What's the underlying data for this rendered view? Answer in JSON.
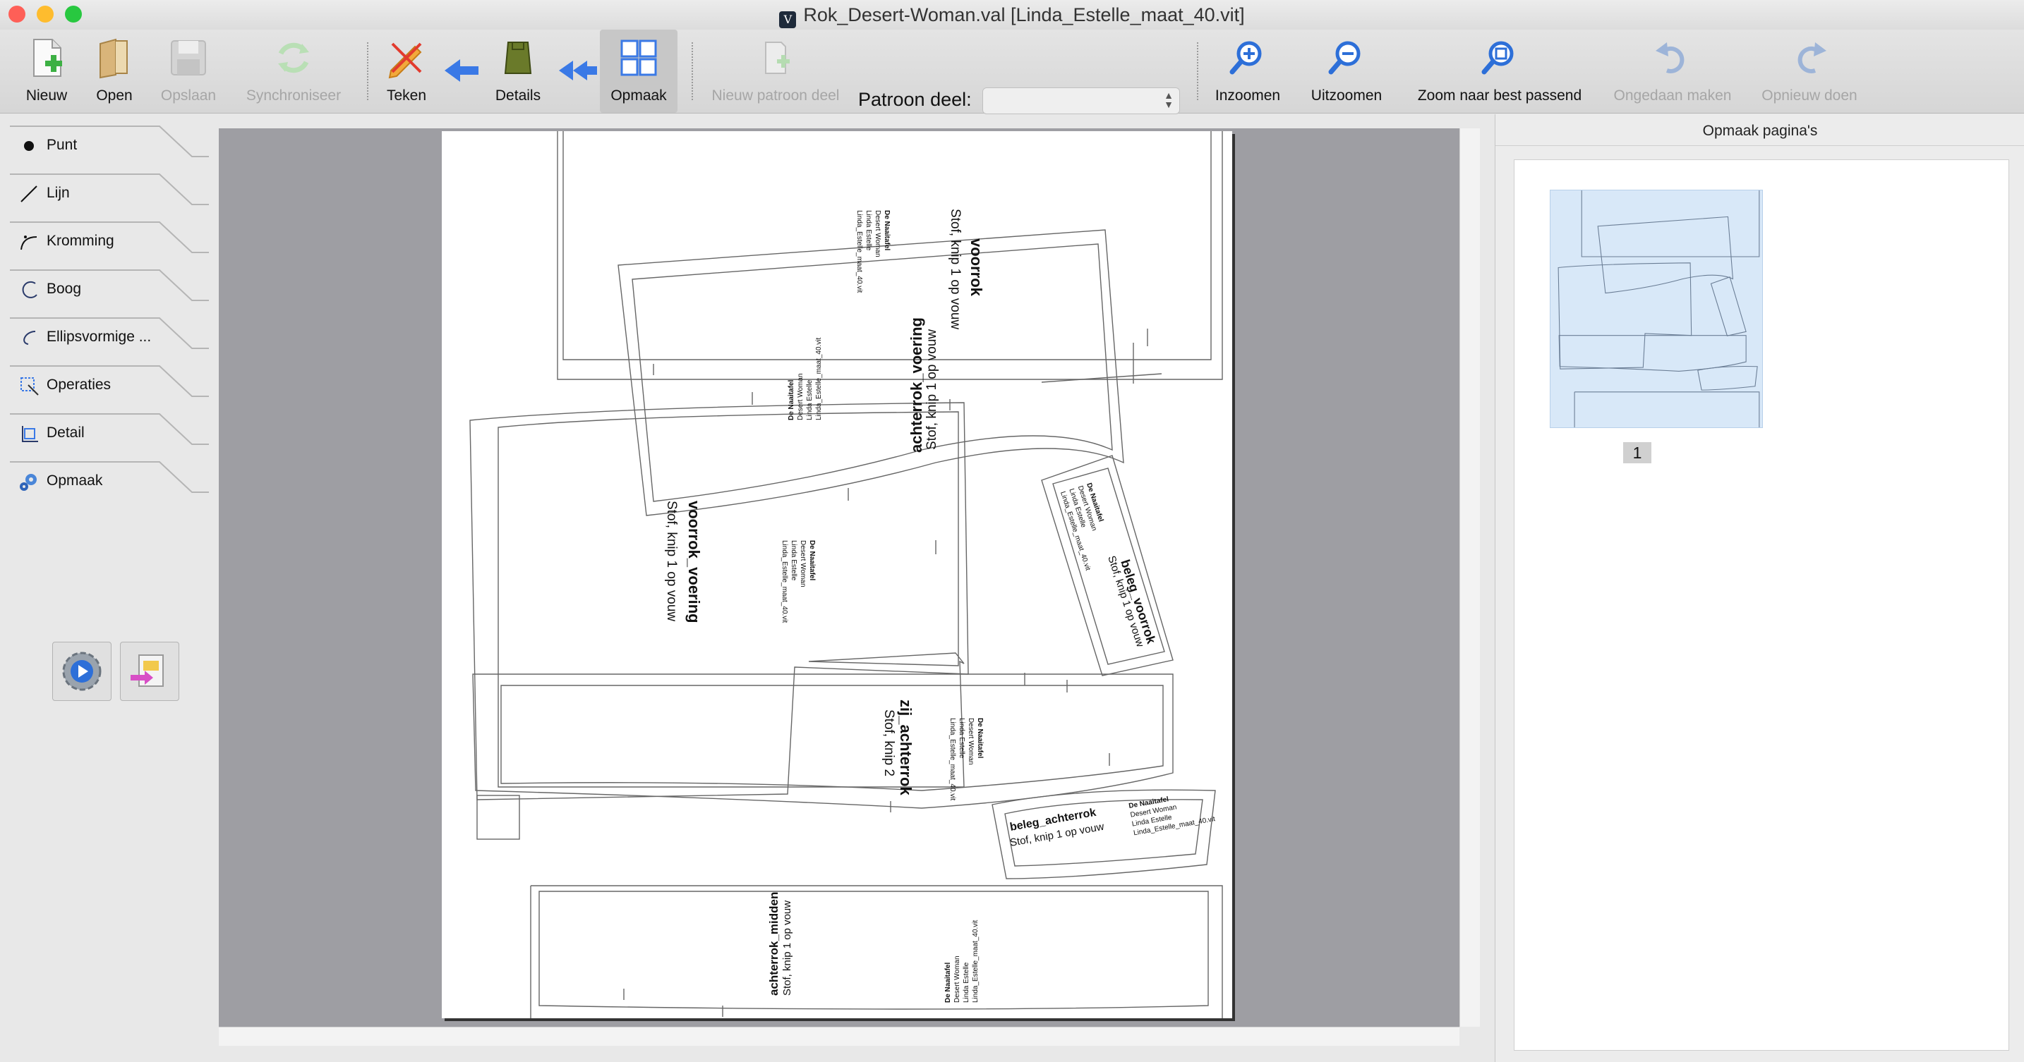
{
  "window": {
    "title": "Rok_Desert-Woman.val [Linda_Estelle_maat_40.vit]",
    "traffic_colors": [
      "#fe5f57",
      "#febc2e",
      "#28c840"
    ]
  },
  "toolbar": {
    "buttons": [
      {
        "label": "Nieuw",
        "icon": "new-document-icon"
      },
      {
        "label": "Open",
        "icon": "open-folder-icon"
      },
      {
        "label": "Opslaan",
        "icon": "save-disk-icon"
      },
      {
        "label": "Synchroniseer",
        "icon": "sync-icon"
      },
      {
        "label": "Teken",
        "icon": "draw-pencil-icon"
      },
      {
        "label": "Details",
        "icon": "details-garment-icon"
      },
      {
        "label": "Opmaak",
        "icon": "layout-icon"
      },
      {
        "label": "Nieuw patroon deel",
        "icon": "new-pattern-piece-icon"
      },
      {
        "label": "Inzoomen",
        "icon": "zoom-in-icon"
      },
      {
        "label": "Uitzoomen",
        "icon": "zoom-out-icon"
      },
      {
        "label": "Zoom  naar best passend",
        "icon": "zoom-fit-icon"
      },
      {
        "label": "Ongedaan maken",
        "icon": "undo-icon"
      },
      {
        "label": "Opnieuw doen",
        "icon": "redo-icon"
      }
    ],
    "pattern_piece_label": "Patroon deel:",
    "pattern_piece_value": ""
  },
  "sidebar": {
    "tools": [
      {
        "label": "Punt",
        "icon": "point-icon"
      },
      {
        "label": "Lijn",
        "icon": "line-icon"
      },
      {
        "label": "Kromming",
        "icon": "curve-icon"
      },
      {
        "label": "Boog",
        "icon": "arc-icon"
      },
      {
        "label": "Ellipsvormige ...",
        "icon": "elliptical-arc-icon"
      },
      {
        "label": "Operaties",
        "icon": "operations-icon"
      },
      {
        "label": "Detail",
        "icon": "detail-icon"
      },
      {
        "label": "Opmaak",
        "icon": "layout-gear-icon"
      }
    ]
  },
  "layout_sheet": {
    "pieces": {
      "voorrok": {
        "name": "voorrok",
        "cut": "Stof, knip 1 op vouw"
      },
      "achterrok_voering": {
        "name": "achterrok_voering",
        "cut": "Stof, knip 1 op vouw"
      },
      "voorrok_voering": {
        "name": "voorrok_voering",
        "cut": "Stof, knip 1 op vouw"
      },
      "beleg_voorrok": {
        "name": "beleg_voorrok",
        "cut": "Stof, knip 1 op vouw"
      },
      "zij_achterrok": {
        "name": "zij_achterrok",
        "cut": "Stof, knip 2"
      },
      "beleg_achterrok": {
        "name": "beleg_achterrok",
        "cut": "Stof, knip 1 op vouw"
      },
      "achterrok_midden": {
        "name": "achterrok_midden",
        "cut": "Stof, knip 1 op vouw"
      }
    },
    "info": {
      "company": "De Naaitafel",
      "pattern": "Desert Woman",
      "customer": "Linda Estelle",
      "file": "Linda_Estelle_maat_40.vit"
    }
  },
  "right_panel": {
    "title": "Opmaak pagina's",
    "pages": [
      {
        "number": "1"
      }
    ]
  }
}
